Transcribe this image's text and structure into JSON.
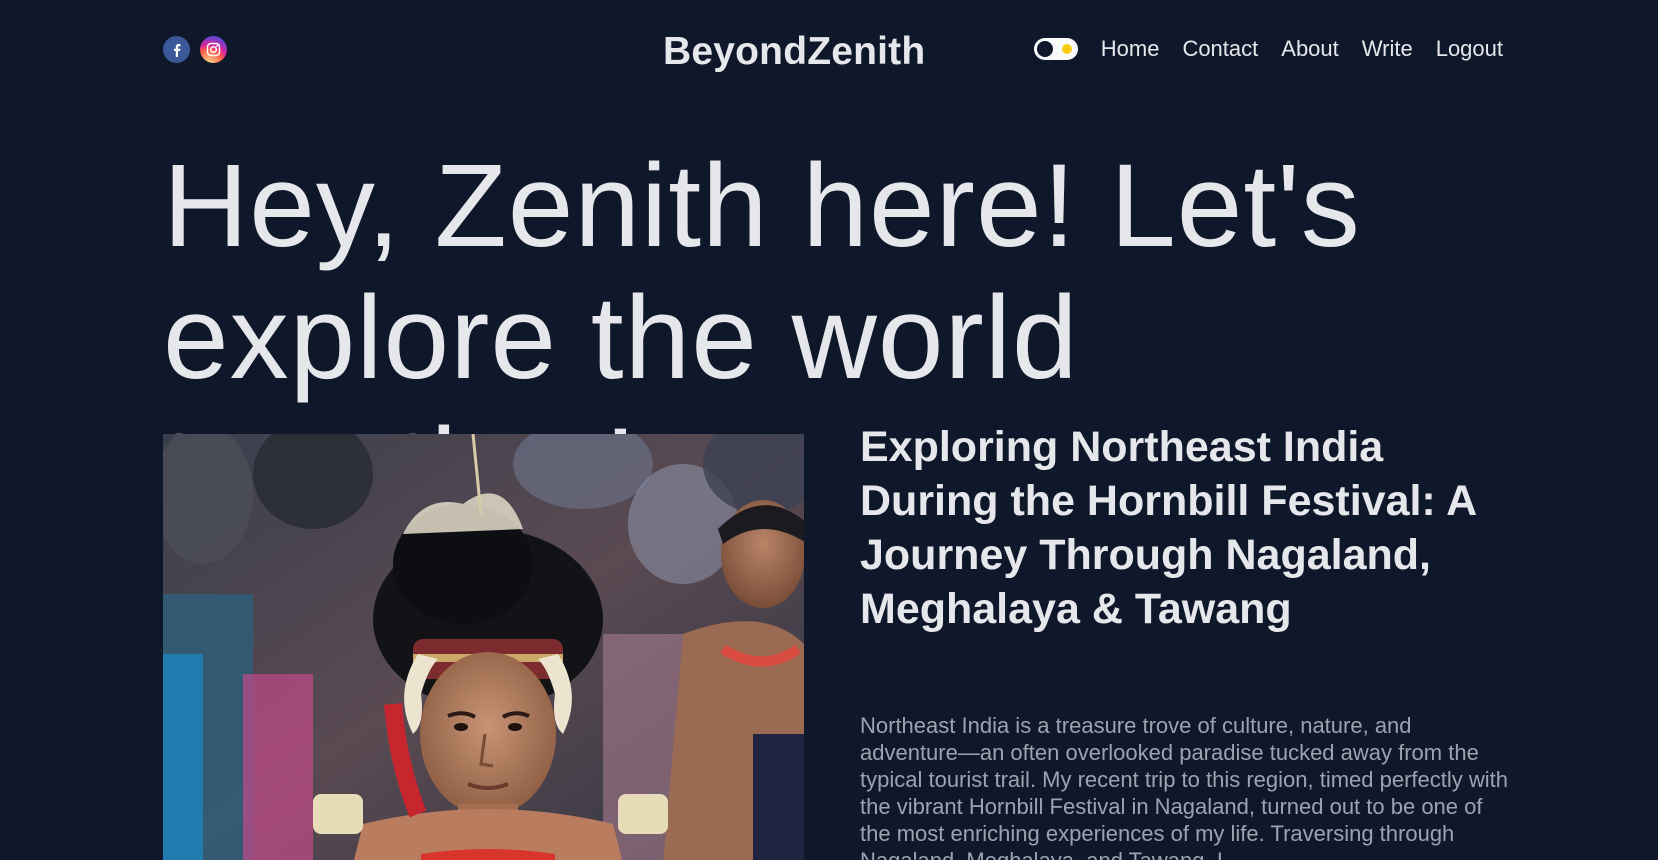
{
  "header": {
    "brand": "BeyondZenith",
    "nav": [
      "Home",
      "Contact",
      "About",
      "Write",
      "Logout"
    ],
    "socials": [
      "facebook-icon",
      "instagram-icon"
    ],
    "theme_toggle": "theme-toggle"
  },
  "hero": {
    "greeting": "Hey, Zenith here!",
    "tagline": " Let's explore the world together!"
  },
  "featured_post": {
    "title": "Exploring Northeast India During the Hornbill Festival: A Journey Through Nagaland, Meghalaya & Tawang",
    "excerpt": "Northeast India is a treasure trove of culture, nature, and adventure—an often overlooked paradise tucked away from the typical tourist trail. My recent trip to this region, timed perfectly with the vibrant Hornbill Festival in Nagaland, turned out to be one of the most enriching experiences of my life. Traversing through Nagaland, Meghalaya, and Tawang, I"
  },
  "colors": {
    "background": "#0f172a",
    "text": "#e5e7eb",
    "muted": "#9ca3af",
    "toggle_sun": "#facc15"
  }
}
